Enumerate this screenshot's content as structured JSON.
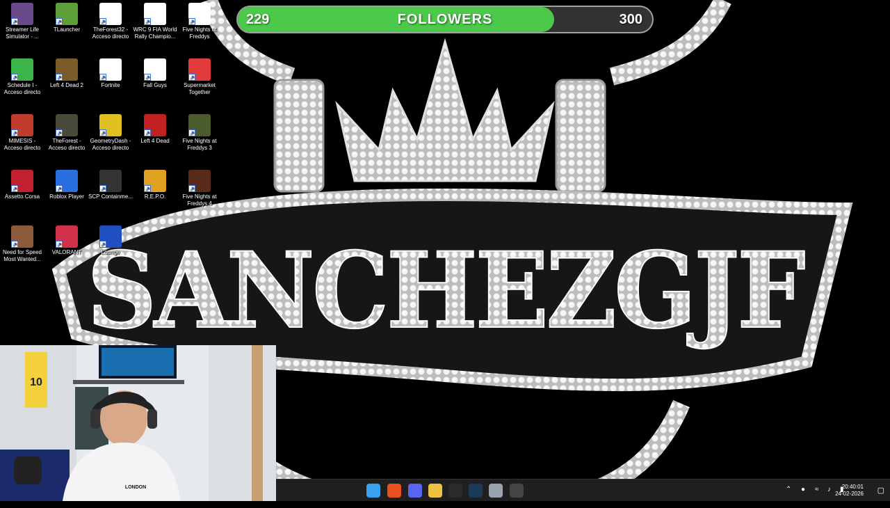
{
  "desktop": {
    "icons": [
      {
        "label": "Streamer Life Simulator - ...",
        "color": "#6a4a8a"
      },
      {
        "label": "TLauncher",
        "color": "#5d9e3a"
      },
      {
        "label": "TheForest32 - Acceso directo",
        "color": "#ffffff"
      },
      {
        "label": "WRC 9 FIA World Rally Champio...",
        "color": "#ffffff"
      },
      {
        "label": "Five Nights at Freddys",
        "color": "#ffffff"
      },
      {
        "label": "Schedule I - Acceso directo",
        "color": "#3bb54a"
      },
      {
        "label": "Left 4 Dead 2",
        "color": "#7a5a2a"
      },
      {
        "label": "Fortnite",
        "color": "#ffffff"
      },
      {
        "label": "Fall Guys",
        "color": "#ffffff"
      },
      {
        "label": "Supermarket Together",
        "color": "#e23b3b"
      },
      {
        "label": "MIMESIS - Acceso directo",
        "color": "#c23b2f"
      },
      {
        "label": "TheForest - Acceso directo",
        "color": "#4a4a3a"
      },
      {
        "label": "GeometryDash - Acceso directo",
        "color": "#e0c020"
      },
      {
        "label": "Left 4 Dead",
        "color": "#c02020"
      },
      {
        "label": "Five Nights at Freddys 3",
        "color": "#4a5a2a"
      },
      {
        "label": "Assetto Corsa",
        "color": "#c02030"
      },
      {
        "label": "Roblox Player",
        "color": "#2a6fe0"
      },
      {
        "label": "SCP Containme...",
        "color": "#333333"
      },
      {
        "label": "R.E.P.O.",
        "color": "#e0a020"
      },
      {
        "label": "Five Nights at Freddys 4",
        "color": "#5a2a1a"
      },
      {
        "label": "Need for Speed Most Wanted...",
        "color": "#8a5a3a"
      },
      {
        "label": "VALORANT",
        "color": "#d0304a"
      },
      {
        "label": "Lounge",
        "color": "#2050c0"
      }
    ]
  },
  "wallpaper": {
    "logo_text": "SANCHEZGJF"
  },
  "follower_goal": {
    "title": "FOLLOWERS",
    "current": "229",
    "target": "300",
    "progress_fraction": 0.763,
    "fill_color": "#4cc84a"
  },
  "webcam": {
    "shirt_text": "LONDON",
    "jersey_number": "10"
  },
  "taskbar": {
    "apps": [
      {
        "name": "start-icon",
        "color": "#3aa0f0"
      },
      {
        "name": "brave-browser-icon",
        "color": "#e8501f"
      },
      {
        "name": "discord-icon",
        "color": "#5865f2"
      },
      {
        "name": "file-explorer-icon",
        "color": "#f0c040"
      },
      {
        "name": "epic-games-icon",
        "color": "#2a2a2a"
      },
      {
        "name": "steam-icon",
        "color": "#1b3a5a"
      },
      {
        "name": "settings-icon",
        "color": "#9aa4b0"
      },
      {
        "name": "obs-icon",
        "color": "#444444"
      }
    ],
    "time": "20:40:01",
    "date": "24-02-2026"
  }
}
